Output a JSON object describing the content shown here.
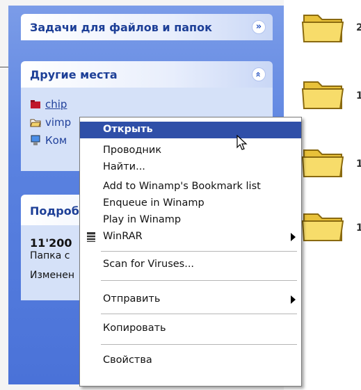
{
  "tasks_panel": {
    "title": "Задачи для файлов и папок"
  },
  "places_panel": {
    "title": "Другие места",
    "items": [
      {
        "label": "chip",
        "icon": "red-folder-icon"
      },
      {
        "label": "vimp",
        "icon": "folder-open-icon"
      },
      {
        "label": "Ком",
        "icon": "computer-icon"
      }
    ]
  },
  "details_panel": {
    "title": "Подроб",
    "name": "11'200",
    "type": "Папка с",
    "modified": "Изменен"
  },
  "right_pane": {
    "items": [
      "2",
      "1",
      "1",
      "1"
    ]
  },
  "context_menu": {
    "items": [
      {
        "label": "Открыть",
        "selected": true
      },
      {
        "label": "Проводник"
      },
      {
        "label": "Найти..."
      },
      {
        "label": "Add to Winamp's Bookmark list"
      },
      {
        "label": "Enqueue in Winamp"
      },
      {
        "label": "Play in Winamp"
      },
      {
        "label": "WinRAR",
        "submenu": true,
        "icon": "winrar-icon"
      },
      {
        "label": "Scan for Viruses..."
      },
      {
        "label": "Отправить",
        "submenu": true
      },
      {
        "label": "Копировать"
      },
      {
        "label": "Свойства"
      }
    ]
  },
  "colors": {
    "sidebar": "#5a82e0",
    "selection": "#2f4fa8",
    "link": "#20409a"
  }
}
